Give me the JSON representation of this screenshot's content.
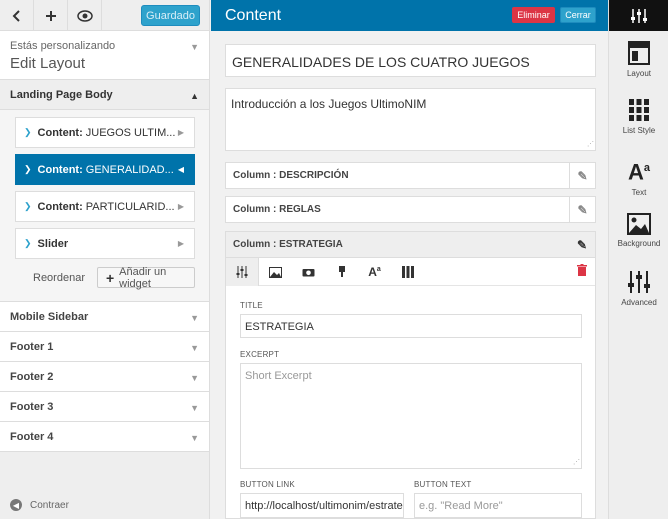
{
  "left": {
    "saved_label": "Guardado",
    "customizing_small": "Estás personalizando",
    "customizing_big": "Edit Layout",
    "landing": "Landing Page Body",
    "widgets": [
      {
        "prefix": "Content:",
        "name": "JUEGOS ULTIM..."
      },
      {
        "prefix": "Content:",
        "name": "GENERALIDAD..."
      },
      {
        "prefix": "Content:",
        "name": "PARTICULARID..."
      },
      {
        "prefix": "Slider",
        "name": ""
      }
    ],
    "reorder": "Reordenar",
    "add_widget": "Añadir un widget",
    "sections": [
      "Mobile Sidebar",
      "Footer 1",
      "Footer 2",
      "Footer 3",
      "Footer 4"
    ],
    "collapse": "Contraer"
  },
  "editor": {
    "header": "Content",
    "delete_label": "Eliminar",
    "close_label": "Cerrar",
    "title_value": "GENERALIDADES DE LOS CUATRO JUEGOS",
    "intro_value": "Introducción a los Juegos UltimoNIM",
    "columns": [
      "Column : DESCRIPCIÓN",
      "Column : REGLAS",
      "Column : ESTRATEGIA"
    ],
    "fields": {
      "title_label": "TITLE",
      "title_value": "ESTRATEGIA",
      "excerpt_label": "EXCERPT",
      "excerpt_placeholder": "Short Excerpt",
      "button_link_label": "BUTTON LINK",
      "button_link_value": "http://localhost/ultimonim/estrate",
      "button_text_label": "BUTTON TEXT",
      "button_text_placeholder": "e.g. \"Read More\""
    }
  },
  "right": {
    "items": [
      "Layout",
      "List Style",
      "Text",
      "Background",
      "Advanced"
    ]
  },
  "colors": {
    "accent": "#0073aa",
    "button_blue": "#2ea2cc",
    "danger": "#dc3545"
  }
}
